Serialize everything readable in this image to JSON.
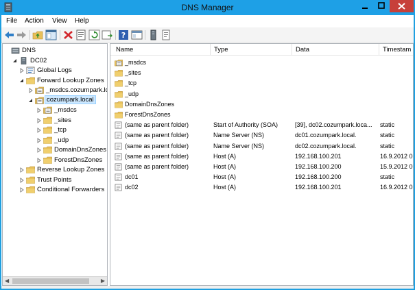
{
  "window": {
    "title": "DNS Manager"
  },
  "menu": {
    "items": [
      "File",
      "Action",
      "View",
      "Help"
    ]
  },
  "toolbar": {
    "buttons": [
      "back-icon",
      "forward-icon",
      "up-folder-icon",
      "show-hide-tree-icon",
      "delete-icon",
      "properties-icon",
      "refresh-icon",
      "export-list-icon",
      "help-icon",
      "console-view-icon",
      "server-icon",
      "new-record-icon"
    ]
  },
  "tree": {
    "nodes": [
      {
        "label": "DNS",
        "depth": 0,
        "expander": "none",
        "icon": "dns-icon"
      },
      {
        "label": "DC02",
        "depth": 1,
        "expander": "open",
        "icon": "server-icon"
      },
      {
        "label": "Global Logs",
        "depth": 2,
        "expander": "closed",
        "icon": "logs-icon"
      },
      {
        "label": "Forward Lookup Zones",
        "depth": 2,
        "expander": "open",
        "icon": "folder-icon"
      },
      {
        "label": "_msdcs.cozumpark.lo",
        "depth": 3,
        "expander": "closed",
        "icon": "zone-icon"
      },
      {
        "label": "cozumpark.local",
        "depth": 3,
        "expander": "open",
        "icon": "zone-icon",
        "selected": true
      },
      {
        "label": "_msdcs",
        "depth": 4,
        "expander": "closed",
        "icon": "zone-icon"
      },
      {
        "label": "_sites",
        "depth": 4,
        "expander": "closed",
        "icon": "folder-icon"
      },
      {
        "label": "_tcp",
        "depth": 4,
        "expander": "closed",
        "icon": "folder-icon"
      },
      {
        "label": "_udp",
        "depth": 4,
        "expander": "closed",
        "icon": "folder-icon"
      },
      {
        "label": "DomainDnsZones",
        "depth": 4,
        "expander": "closed",
        "icon": "folder-icon"
      },
      {
        "label": "ForestDnsZones",
        "depth": 4,
        "expander": "closed",
        "icon": "folder-icon"
      },
      {
        "label": "Reverse Lookup Zones",
        "depth": 2,
        "expander": "closed",
        "icon": "folder-icon"
      },
      {
        "label": "Trust Points",
        "depth": 2,
        "expander": "closed",
        "icon": "folder-icon"
      },
      {
        "label": "Conditional Forwarders",
        "depth": 2,
        "expander": "closed",
        "icon": "folder-icon"
      }
    ]
  },
  "list": {
    "columns": [
      "Name",
      "Type",
      "Data",
      "Timestam"
    ],
    "rows": [
      {
        "name": "_msdcs",
        "type": "",
        "data": "",
        "timestamp": "",
        "icon": "zone-icon"
      },
      {
        "name": "_sites",
        "type": "",
        "data": "",
        "timestamp": "",
        "icon": "folder-icon"
      },
      {
        "name": "_tcp",
        "type": "",
        "data": "",
        "timestamp": "",
        "icon": "folder-icon"
      },
      {
        "name": "_udp",
        "type": "",
        "data": "",
        "timestamp": "",
        "icon": "folder-icon"
      },
      {
        "name": "DomainDnsZones",
        "type": "",
        "data": "",
        "timestamp": "",
        "icon": "folder-icon"
      },
      {
        "name": "ForestDnsZones",
        "type": "",
        "data": "",
        "timestamp": "",
        "icon": "folder-icon"
      },
      {
        "name": "(same as parent folder)",
        "type": "Start of Authority (SOA)",
        "data": "[39], dc02.cozumpark.loca...",
        "timestamp": "static",
        "icon": "record-icon"
      },
      {
        "name": "(same as parent folder)",
        "type": "Name Server (NS)",
        "data": "dc01.cozumpark.local.",
        "timestamp": "static",
        "icon": "record-icon"
      },
      {
        "name": "(same as parent folder)",
        "type": "Name Server (NS)",
        "data": "dc02.cozumpark.local.",
        "timestamp": "static",
        "icon": "record-icon"
      },
      {
        "name": "(same as parent folder)",
        "type": "Host (A)",
        "data": "192.168.100.201",
        "timestamp": "16.9.2012 0",
        "icon": "record-icon"
      },
      {
        "name": "(same as parent folder)",
        "type": "Host (A)",
        "data": "192.168.100.200",
        "timestamp": "15.9.2012 0",
        "icon": "record-icon"
      },
      {
        "name": "dc01",
        "type": "Host (A)",
        "data": "192.168.100.200",
        "timestamp": "static",
        "icon": "record-icon"
      },
      {
        "name": "dc02",
        "type": "Host (A)",
        "data": "192.168.100.201",
        "timestamp": "16.9.2012 0",
        "icon": "record-icon"
      }
    ]
  },
  "colors": {
    "titlebar": "#1ea0e6",
    "close": "#c7403a",
    "selection": "#cde8ff",
    "folder": "#e8c05a"
  }
}
